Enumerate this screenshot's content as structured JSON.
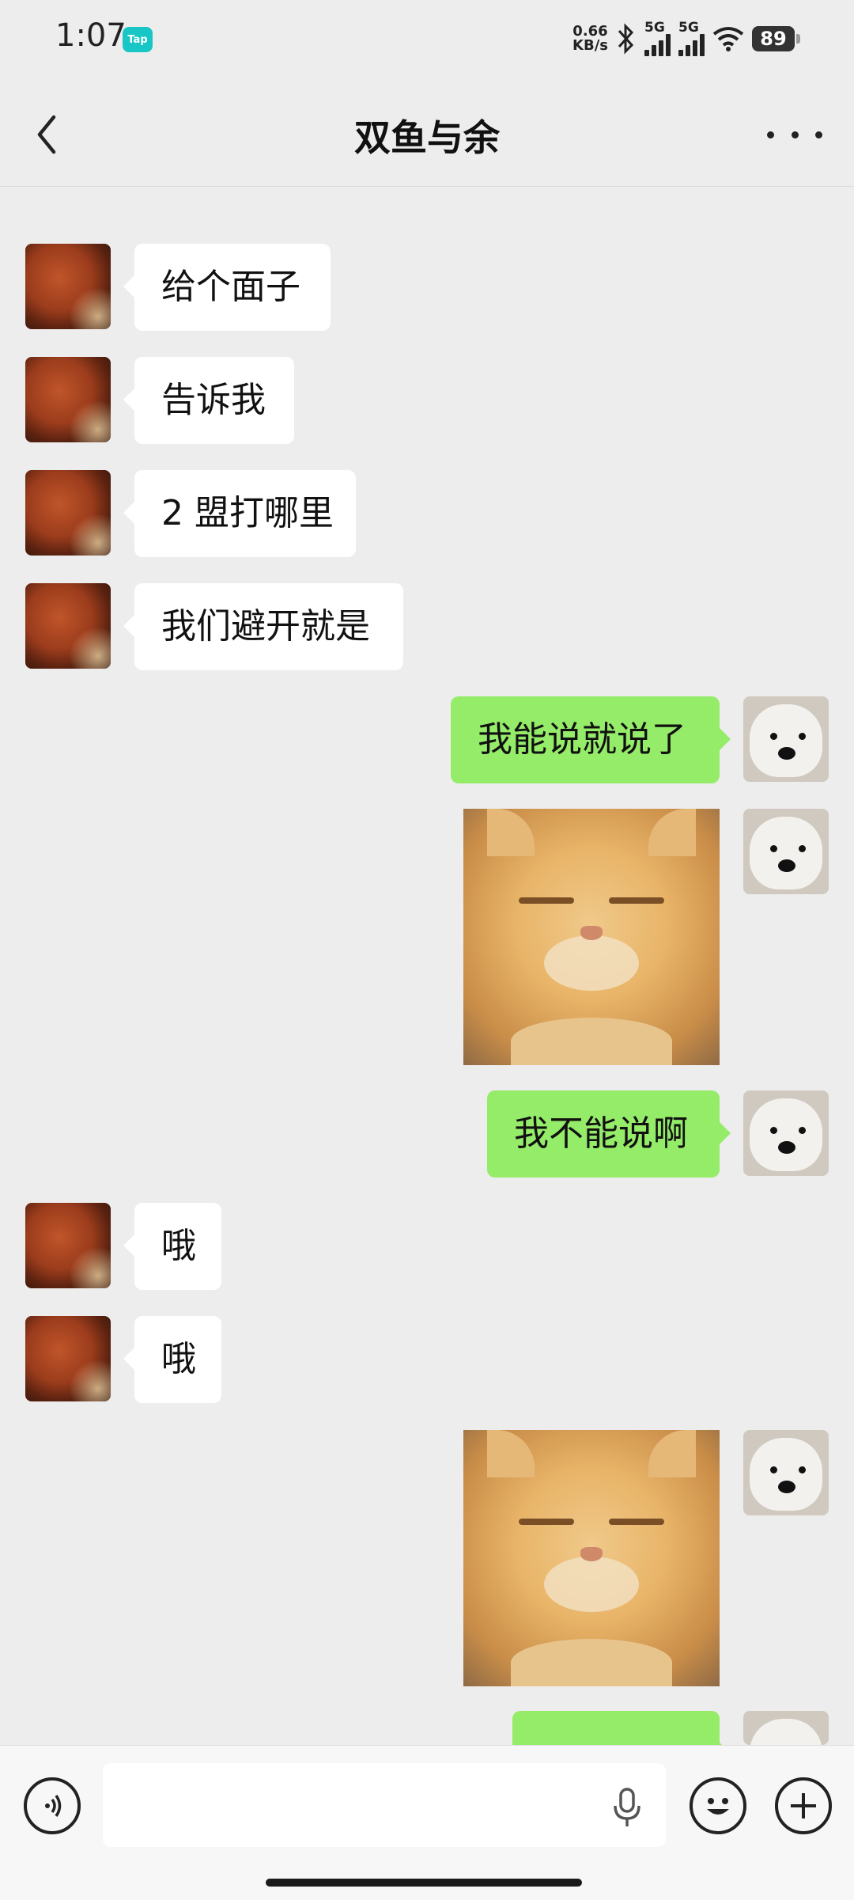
{
  "status_bar": {
    "time": "1:07",
    "app_badge": "Tap",
    "net_speed_value": "0.66",
    "net_speed_unit": "KB/s",
    "signal_1_label": "5G",
    "signal_2_label": "5G",
    "battery": "89"
  },
  "header": {
    "title": "双鱼与余",
    "icons": {
      "back": "back-chevron-icon",
      "more": "more-dots-icon"
    }
  },
  "messages": [
    {
      "side": "in",
      "type": "text",
      "text": "给个面子"
    },
    {
      "side": "in",
      "type": "text",
      "text": "告诉我"
    },
    {
      "side": "in",
      "type": "text",
      "text": "2 盟打哪里"
    },
    {
      "side": "in",
      "type": "text",
      "text": "我们避开就是"
    },
    {
      "side": "out",
      "type": "text",
      "text": "我能说就说了"
    },
    {
      "side": "out",
      "type": "sticker",
      "sticker": "cat-sticker"
    },
    {
      "side": "out",
      "type": "text",
      "text": "我不能说啊"
    },
    {
      "side": "in",
      "type": "text",
      "text": "哦"
    },
    {
      "side": "in",
      "type": "text",
      "text": "哦"
    },
    {
      "side": "out",
      "type": "sticker",
      "sticker": "cat-sticker"
    },
    {
      "side": "out",
      "type": "text",
      "text": ""
    }
  ],
  "input_bar": {
    "value": "",
    "icons": {
      "voice": "voice-icon",
      "mic": "microphone-icon",
      "emoji": "emoji-icon",
      "add": "plus-icon"
    }
  },
  "colors": {
    "background": "#ededed",
    "incoming_bubble": "#ffffff",
    "outgoing_bubble": "#95ec69"
  }
}
